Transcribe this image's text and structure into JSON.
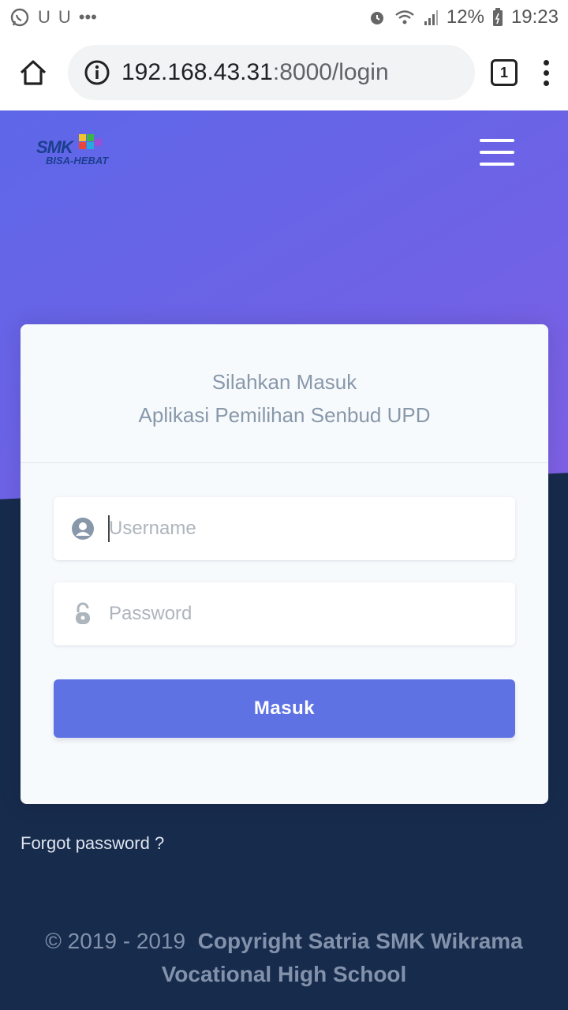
{
  "status_bar": {
    "left_icons": [
      "whatsapp-icon",
      "u-notification-icon",
      "u-notification-icon",
      "more-dots-icon"
    ],
    "battery": "12%",
    "time": "19:23"
  },
  "browser": {
    "url_host": "192.168.43.31",
    "url_rest": ":8000/login",
    "tab_count": "1"
  },
  "brand": {
    "logo_smk": "SMK",
    "logo_bisa": "BISA-HEBAT"
  },
  "login_card": {
    "title": "Silahkan Masuk",
    "subtitle": "Aplikasi Pemilihan Senbud UPD",
    "username_placeholder": "Username",
    "password_placeholder": "Password",
    "submit_label": "Masuk"
  },
  "forgot_password": "Forgot password ?",
  "footer": {
    "years": "© 2019 - 2019",
    "copyright": "Copyright Satria SMK Wikrama Vocational High School"
  },
  "colors": {
    "primary": "#5e72e4",
    "hero_start": "#5e67e8",
    "hero_end": "#8260e4",
    "background": "#172b4d"
  }
}
